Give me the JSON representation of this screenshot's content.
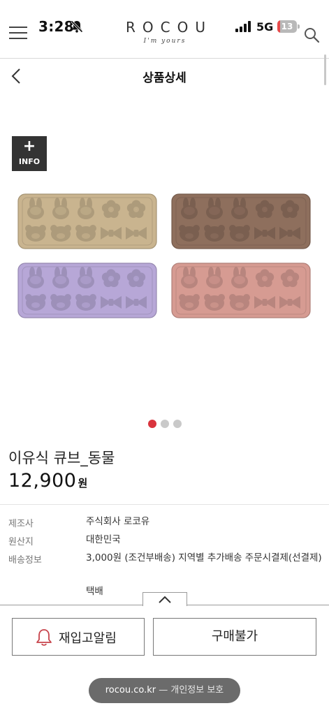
{
  "status_bar": {
    "time": "3:28",
    "network": "5G",
    "battery_level": "13",
    "battery_fraction": 0.13
  },
  "header": {
    "logo_name": "ROCOU",
    "logo_tagline": "I'm yours",
    "icons": [
      "menu-icon",
      "search-icon",
      "bell-off-icon",
      "signal-icon"
    ]
  },
  "titlebar": {
    "title": "상품상세",
    "back_icon": "chevron-left-icon"
  },
  "gallery": {
    "info_badge_plus": "+",
    "info_badge_label": "INFO",
    "slide_count": 3,
    "active_slide": 0,
    "tray_colors": [
      "#c9b48f",
      "#8e6f5d",
      "#b7a7d7",
      "#d69b92"
    ]
  },
  "product": {
    "name": "이유식 큐브_동물",
    "price": "12,900",
    "price_unit": "원"
  },
  "specs": [
    {
      "label": "제조사",
      "value": "주식회사 로코유"
    },
    {
      "label": "원산지",
      "value": "대한민국"
    },
    {
      "label": "배송정보",
      "value": "3,000원 (조건부배송) 지역별 추가배송 주문시결제(선결제)"
    },
    {
      "label": "",
      "value": "택배"
    }
  ],
  "bottom_bar": {
    "restock_label": "재입고알림",
    "buy_label": "구매불가",
    "url_domain": "rocou.co.kr",
    "url_suffix": " — 개인정보 보호"
  },
  "colors": {
    "accent_dot": "#d9343d",
    "bell_icon": "#c7434b",
    "battery_low": "#e84a4a"
  }
}
